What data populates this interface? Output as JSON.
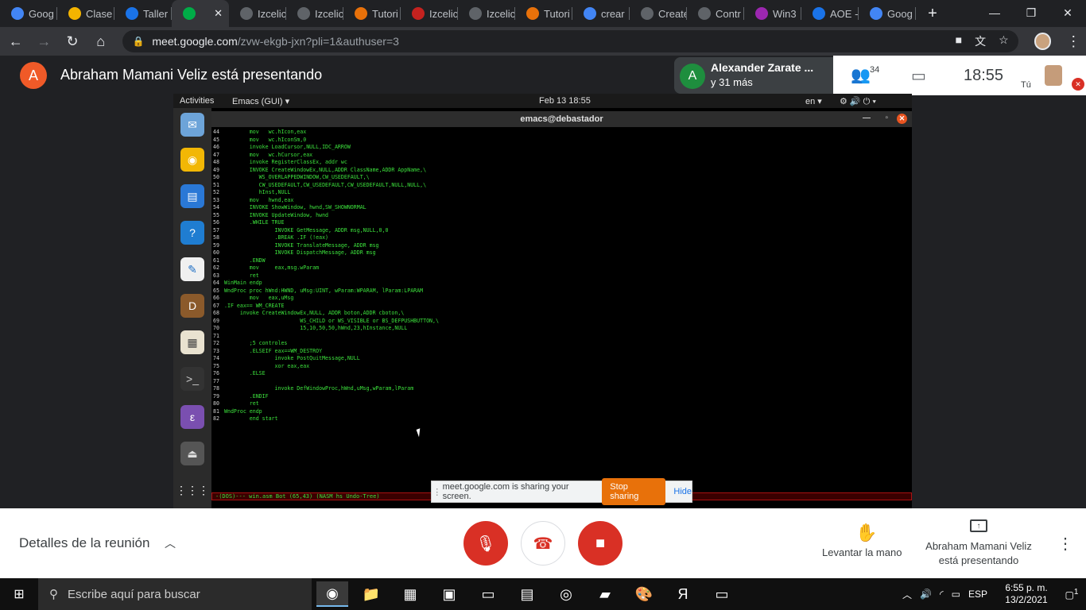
{
  "browser": {
    "tabs": [
      {
        "label": "Goog",
        "icon": "google-g-icon",
        "color": "#4285f4"
      },
      {
        "label": "Clase",
        "icon": "classroom-icon",
        "color": "#f4b400"
      },
      {
        "label": "Taller",
        "icon": "classroom-blue-icon",
        "color": "#1a73e8"
      },
      {
        "label": "",
        "icon": "meet-icon",
        "color": "#00ac47",
        "active": true
      },
      {
        "label": "Izcelic",
        "icon": "globe-icon",
        "color": "#5f6368"
      },
      {
        "label": "Izcelic",
        "icon": "globe-icon",
        "color": "#5f6368"
      },
      {
        "label": "Tutori",
        "icon": "gitbook-icon",
        "color": "#e8710a"
      },
      {
        "label": "Izcelic",
        "icon": "m-icon",
        "color": "#c5221f"
      },
      {
        "label": "Izcelic",
        "icon": "globe-icon",
        "color": "#5f6368"
      },
      {
        "label": "Tutori",
        "icon": "gitbook-icon",
        "color": "#e8710a"
      },
      {
        "label": "crear",
        "icon": "google-g-icon",
        "color": "#4285f4"
      },
      {
        "label": "Create",
        "icon": "globe-icon",
        "color": "#5f6368"
      },
      {
        "label": "Contr",
        "icon": "globe-icon",
        "color": "#5f6368"
      },
      {
        "label": "Win3",
        "icon": "winrar-icon",
        "color": "#9c27b0"
      },
      {
        "label": "AOE -",
        "icon": "shield-icon",
        "color": "#1a73e8"
      },
      {
        "label": "Goog",
        "icon": "google-g-icon",
        "color": "#4285f4"
      }
    ],
    "url_host": "meet.google.com",
    "url_path": "/zvw-ekgb-jxn?pli=1&authuser=3"
  },
  "meet": {
    "presenter_initial": "A",
    "presenting_text": "Abraham Mamani Veliz está presentando",
    "participant_initial": "A",
    "participant_name": "Alexander Zarate ...",
    "participant_more": "y 31 más",
    "people_count": "34",
    "time": "18:55",
    "self_label": "Tú",
    "details_label": "Detalles de la reunión",
    "raise_hand_label": "Levantar la mano",
    "presenting_label_line1": "Abraham Mamani Veliz",
    "presenting_label_line2": "está presentando"
  },
  "shared_screen": {
    "activities": "Activities",
    "app_menu": "Emacs (GUI) ▾",
    "date": "Feb 13  18:55",
    "lang": "en ▾",
    "window_title": "emacs@debastador",
    "modeline": "-(DOS)---  win.asm       Bot (65,43)    (NASM hs Undo-Tree)",
    "share_text": "meet.google.com is sharing your screen.",
    "stop_sharing": "Stop sharing",
    "hide": "Hide",
    "code_lines": [
      [
        "44",
        "        mov   wc.hIcon,eax"
      ],
      [
        "45",
        "        mov   wc.hIconSm,0"
      ],
      [
        "46",
        "        invoke LoadCursor,NULL,IDC_ARROW"
      ],
      [
        "47",
        "        mov   wc.hCursor,eax"
      ],
      [
        "48",
        "        invoke RegisterClassEx, addr wc"
      ],
      [
        "49",
        "        INVOKE CreateWindowEx,NULL,ADDR ClassName,ADDR AppName,\\"
      ],
      [
        "50",
        "           WS_OVERLAPPEDWINDOW,CW_USEDEFAULT,\\"
      ],
      [
        "51",
        "           CW_USEDEFAULT,CW_USEDEFAULT,CW_USEDEFAULT,NULL,NULL,\\"
      ],
      [
        "52",
        "           hInst,NULL"
      ],
      [
        "53",
        "        mov   hwnd,eax"
      ],
      [
        "54",
        "        INVOKE ShowWindow, hwnd,SW_SHOWNORMAL"
      ],
      [
        "55",
        "        INVOKE UpdateWindow, hwnd"
      ],
      [
        "56",
        "        .WHILE TRUE"
      ],
      [
        "57",
        "                INVOKE GetMessage, ADDR msg,NULL,0,0"
      ],
      [
        "58",
        "                .BREAK .IF (!eax)"
      ],
      [
        "59",
        "                INVOKE TranslateMessage, ADDR msg"
      ],
      [
        "60",
        "                INVOKE DispatchMessage, ADDR msg"
      ],
      [
        "61",
        "        .ENDW"
      ],
      [
        "62",
        "        mov     eax,msg.wParam"
      ],
      [
        "63",
        "        ret"
      ],
      [
        "64",
        "WinMain endp"
      ],
      [
        "65",
        "WndProc proc hWnd:HWND, uMsg:UINT, wParam:WPARAM, lParam:LPARAM"
      ],
      [
        "66",
        "        mov   eax,uMsg"
      ],
      [
        "67",
        ".IF eax== WM_CREATE"
      ],
      [
        "68",
        "     invoke CreateWindowEx,NULL, ADDR boton,ADDR cboton,\\"
      ],
      [
        "69",
        "                        WS_CHILD or WS_VISIBLE or BS_DEFPUSHBUTTON,\\"
      ],
      [
        "70",
        "                        15,10,50,50,hWnd,23,hInstance,NULL"
      ],
      [
        "71",
        ""
      ],
      [
        "72",
        "        ;5 controles"
      ],
      [
        "73",
        "        .ELSEIF eax==WM_DESTROY"
      ],
      [
        "74",
        "                invoke PostQuitMessage,NULL"
      ],
      [
        "75",
        "                xor eax,eax"
      ],
      [
        "76",
        "        .ELSE"
      ],
      [
        "77",
        ""
      ],
      [
        "78",
        "                invoke DefWindowProc,hWnd,uMsg,wParam,lParam"
      ],
      [
        "79",
        "        .ENDIF"
      ],
      [
        "80",
        "        ret"
      ],
      [
        "81",
        "WndProc endp"
      ],
      [
        "82",
        "        end start"
      ]
    ]
  },
  "taskbar": {
    "search_placeholder": "Escribe aquí para buscar",
    "lang": "ESP",
    "time": "6:55 p. m.",
    "date": "13/2/2021",
    "notifications": "1"
  }
}
